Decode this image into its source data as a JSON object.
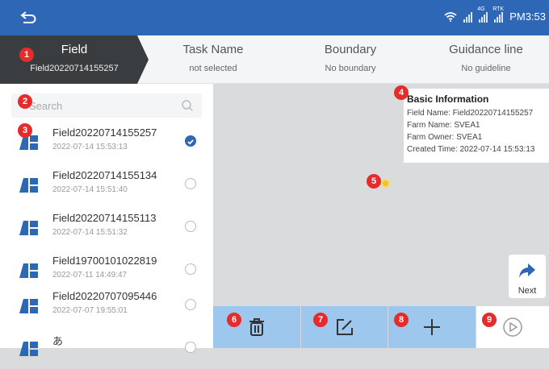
{
  "statusbar": {
    "time": "PM3:53",
    "icons": [
      "wifi-icon",
      "signal-icon",
      "sim-signal-icon",
      "rtk-signal-icon"
    ],
    "sim_label": "4G",
    "rtk_label": "RTK"
  },
  "tabs": [
    {
      "title": "Field",
      "subtitle": "Field20220714155257",
      "active": true
    },
    {
      "title": "Task Name",
      "subtitle": "not selected"
    },
    {
      "title": "Boundary",
      "subtitle": "No boundary"
    },
    {
      "title": "Guidance line",
      "subtitle": "No guideline"
    }
  ],
  "search": {
    "placeholder": "Search"
  },
  "fields": [
    {
      "name": "Field20220714155257",
      "date": "2022-07-14 15:53:13",
      "selected": true
    },
    {
      "name": "Field20220714155134",
      "date": "2022-07-14 15:51:40",
      "selected": false
    },
    {
      "name": "Field20220714155113",
      "date": "2022-07-14 15:51:32",
      "selected": false
    },
    {
      "name": "Field19700101022819",
      "date": "2022-07-11 14:49:47",
      "selected": false
    },
    {
      "name": "Field20220707095446",
      "date": "2022-07-07 19:55:01",
      "selected": false
    },
    {
      "name": "あ",
      "date": "",
      "selected": false
    }
  ],
  "info": {
    "title": "Basic Information",
    "field_name": "Field Name: Field20220714155257",
    "farm_name": "Farm Name: SVEA1",
    "farm_owner": "Farm Owner: SVEA1",
    "created_time": "Created Time: 2022-07-14 15:53:13"
  },
  "next_button": {
    "label": "Next"
  },
  "toolbar": {
    "icons": [
      "trash-icon",
      "edit-icon",
      "add-icon",
      "play-icon"
    ]
  },
  "badges": [
    "1",
    "2",
    "3",
    "4",
    "5",
    "6",
    "7",
    "8",
    "9"
  ],
  "colors": {
    "primary": "#2e67b5",
    "tab_active": "#3a3d40",
    "toolbar_blue": "#9ec7ee",
    "badge_red": "#e52c2a",
    "map_bg": "#d9dbdd"
  }
}
